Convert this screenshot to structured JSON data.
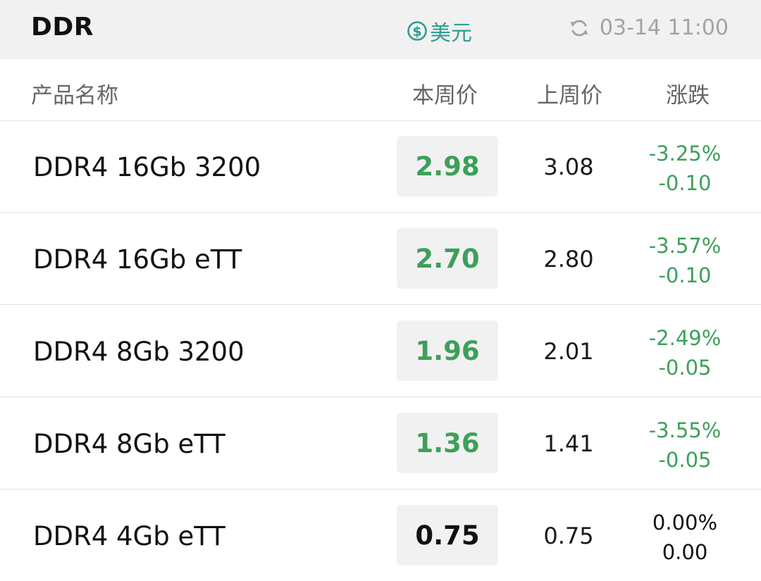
{
  "header": {
    "title": "DDR",
    "currency_label": "美元",
    "currency_icon": "dollar-circle-icon",
    "updated_time": "03-14 11:00",
    "refresh_icon": "refresh-icon"
  },
  "columns": {
    "name": "产品名称",
    "this_week": "本周价",
    "last_week": "上周价",
    "change": "涨跌"
  },
  "colors": {
    "accent": "#2e9e90",
    "down": "#3da05a",
    "neutral": "#111111",
    "header_bg": "#f1f1f1"
  },
  "rows": [
    {
      "name": "DDR4 16Gb 3200",
      "this_week": "2.98",
      "last_week": "3.08",
      "change_pct": "-3.25%",
      "change_abs": "-0.10",
      "trend": "down"
    },
    {
      "name": "DDR4 16Gb eTT",
      "this_week": "2.70",
      "last_week": "2.80",
      "change_pct": "-3.57%",
      "change_abs": "-0.10",
      "trend": "down"
    },
    {
      "name": "DDR4 8Gb 3200",
      "this_week": "1.96",
      "last_week": "2.01",
      "change_pct": "-2.49%",
      "change_abs": "-0.05",
      "trend": "down"
    },
    {
      "name": "DDR4 8Gb eTT",
      "this_week": "1.36",
      "last_week": "1.41",
      "change_pct": "-3.55%",
      "change_abs": "-0.05",
      "trend": "down"
    },
    {
      "name": "DDR4 4Gb eTT",
      "this_week": "0.75",
      "last_week": "0.75",
      "change_pct": "0.00%",
      "change_abs": "0.00",
      "trend": "flat"
    }
  ]
}
